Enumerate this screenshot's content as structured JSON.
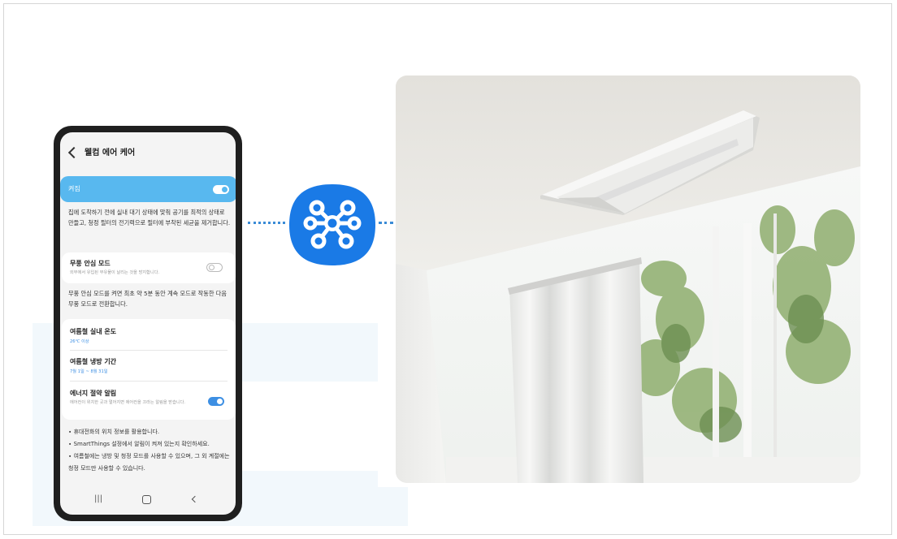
{
  "phone": {
    "title": "웰컴 에어 케어",
    "power": {
      "label": "켜짐",
      "on": true
    },
    "intro": "집에 도착하기 전에 실내 대기 상태에 맞춰 공기를 최적의 상태로 만들고, 청정 필터의 전기력으로 필터에 부착된 세균을 제거합니다.",
    "windless": {
      "title": "무풍 안심 모드",
      "subtitle": "외부에서 유입된 부유물이 날리는 것을 방지합니다.",
      "on": false
    },
    "windless_desc": "무풍 안심 모드를 켜면 최초 약 5분 동안 계속 모드로 작동한 다음 무풍 모드로 전환합니다.",
    "summer_temp": {
      "title": "여름철 실내 온도",
      "value": "26℃ 이상"
    },
    "summer_period": {
      "title": "여름철 냉방 기간",
      "value": "7월 1일 ~ 8월 31일"
    },
    "energy_alert": {
      "title": "에너지 절약 알림",
      "subtitle": "에어컨이 위치한 곳과 멀어지면 에어컨을 끄라는 알림을 받습니다.",
      "on": true
    },
    "notes": [
      "∙ 휴대전화의 위치 정보를 활용합니다.",
      "∙ SmartThings 설정에서 알림이 켜져 있는지 확인하세요.",
      "∙ 여름철에는 냉방 및 청정 모드를 사용할 수 있으며, 그 외 계절에는 청정 모드만 사용할 수 있습니다."
    ],
    "nav": {
      "recent": "|||"
    }
  },
  "icons": {
    "app": "smartthings-app-icon",
    "back": "chevron-left-icon",
    "home": "home-icon"
  },
  "colors": {
    "accent": "#58b8ef",
    "toggle_on": "#3d8fe3",
    "app_icon": "#1a7ae6",
    "connector": "#3a8bd6"
  }
}
